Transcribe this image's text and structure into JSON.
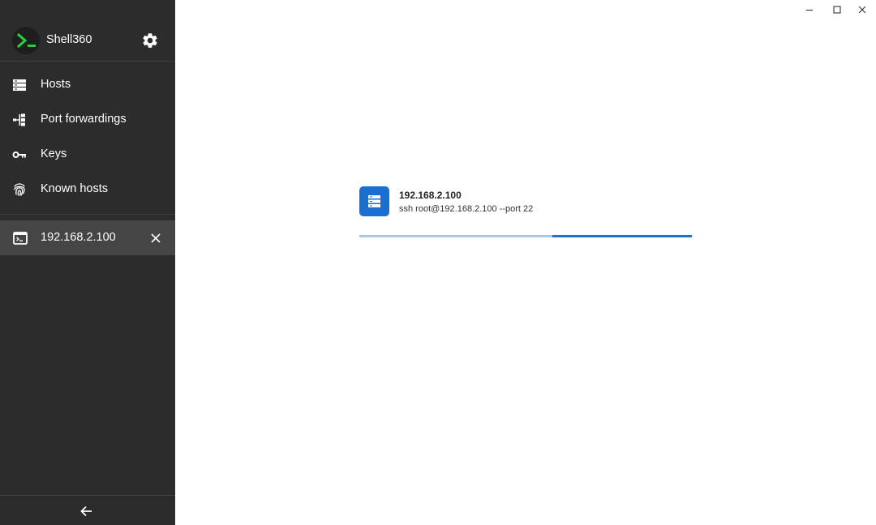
{
  "app": {
    "name": "Shell360"
  },
  "sidebar": {
    "items": [
      {
        "label": "Hosts",
        "icon": "hosts-icon"
      },
      {
        "label": "Port forwardings",
        "icon": "port-forwarding-icon"
      },
      {
        "label": "Keys",
        "icon": "key-icon"
      },
      {
        "label": "Known hosts",
        "icon": "fingerprint-icon"
      }
    ],
    "sessions": [
      {
        "label": "192.168.2.100",
        "icon": "terminal-icon"
      }
    ]
  },
  "connection": {
    "host": "192.168.2.100",
    "command": "ssh root@192.168.2.100 --port 22",
    "progress_start": 0.58,
    "progress_end": 1.0
  },
  "colors": {
    "sidebar_bg": "#2c2c2c",
    "active_session_bg": "#454545",
    "accent_green": "#2ecc40",
    "host_icon_bg": "#1b6fd1",
    "progress_track": "#a8c7ee",
    "progress_fill": "#1a73d0"
  }
}
